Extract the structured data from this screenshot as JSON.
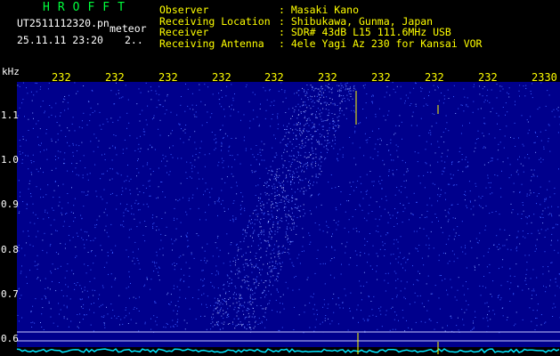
{
  "header": {
    "app_name": "HROFFT",
    "filename": "UT2511112320.pn",
    "meteor_label": "meteor",
    "timestamp": "25.11.11 23:20",
    "counter": "2..",
    "fields": [
      {
        "label": "Observer",
        "value": ": Masaki Kano"
      },
      {
        "label": "Receiving Location",
        "value": ": Shibukawa, Gunma, Japan"
      },
      {
        "label": "Receiver",
        "value": ": SDR# 43dB L15 111.6MHz USB"
      },
      {
        "label": "Receiving Antenna",
        "value": ": 4ele Yagi Az 230 for Kansai VOR"
      }
    ]
  },
  "chart_data": {
    "type": "heatmap",
    "title": "",
    "ylabel": "kHz",
    "xlabel": "",
    "x_tick_labels": [
      "232",
      "232",
      "232",
      "232",
      "232",
      "232",
      "232",
      "232",
      "232",
      "232",
      "2330"
    ],
    "y_ticks": [
      1.1,
      1.0,
      0.9,
      0.8,
      0.7,
      0.6
    ],
    "y_tick_labels": [
      "1.1",
      "1.0",
      "0.9",
      "0.8",
      "0.7",
      "0.6"
    ],
    "ylim": [
      0.58,
      1.18
    ],
    "reference_lines_khz": [
      0.616,
      0.596,
      0.579
    ],
    "colors": {
      "background": "#00008c",
      "noise": "#3a5cff",
      "baseline": "#00e5ff",
      "marker": "#ffff00"
    }
  }
}
